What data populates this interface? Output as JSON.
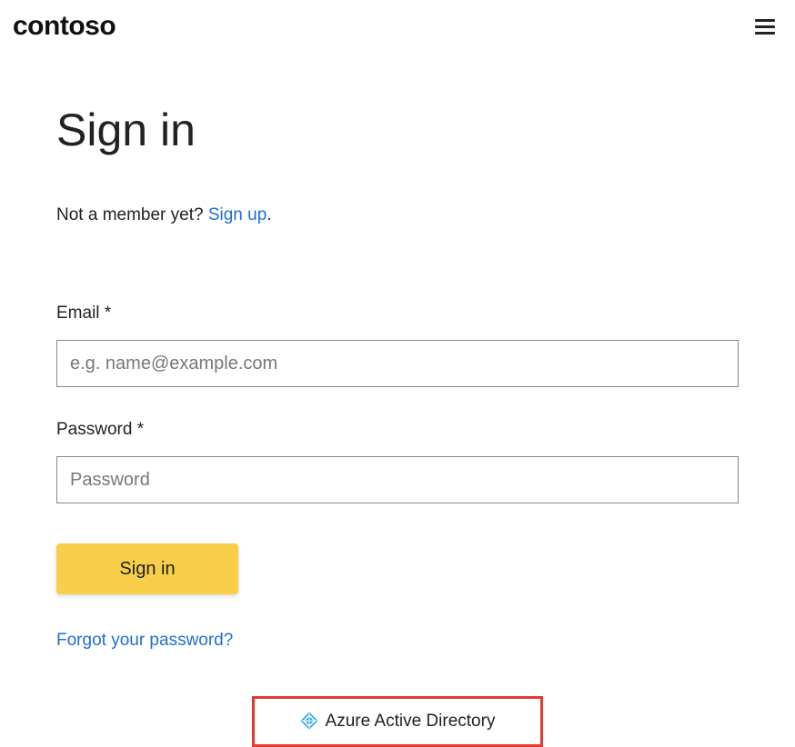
{
  "header": {
    "brand": "contoso"
  },
  "page": {
    "title": "Sign in",
    "not_member_text": "Not a member yet? ",
    "signup_link": "Sign up",
    "period": "."
  },
  "form": {
    "email_label": "Email *",
    "email_placeholder": "e.g. name@example.com",
    "password_label": "Password *",
    "password_placeholder": "Password",
    "signin_button": "Sign in",
    "forgot_link": "Forgot your password?"
  },
  "sso": {
    "aad_label": "Azure Active Directory"
  },
  "colors": {
    "primary_button": "#f7cf4a",
    "link": "#1f6fd1",
    "highlight_border": "#e23b2e",
    "aad_icon": "#29a6dd"
  }
}
